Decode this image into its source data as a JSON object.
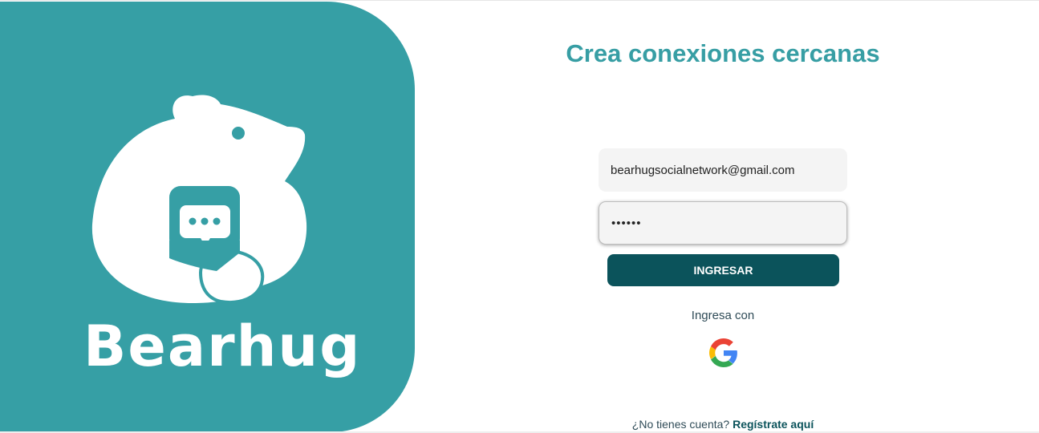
{
  "brand": {
    "name": "Bearhug",
    "panel_color": "#369fa5"
  },
  "login": {
    "headline": "Crea conexiones cercanas",
    "email_value": "bearhugsocialnetwork@gmail.com",
    "password_value": "••••••",
    "submit_label": "INGRESAR",
    "alt_login_label": "Ingresa con",
    "google_icon": "google-g-icon",
    "signup_prompt": "¿No tienes cuenta?",
    "signup_link": "Regístrate aquí"
  },
  "colors": {
    "accent": "#379ea4",
    "button": "#0b535b",
    "field_bg": "#f4f4f4"
  }
}
